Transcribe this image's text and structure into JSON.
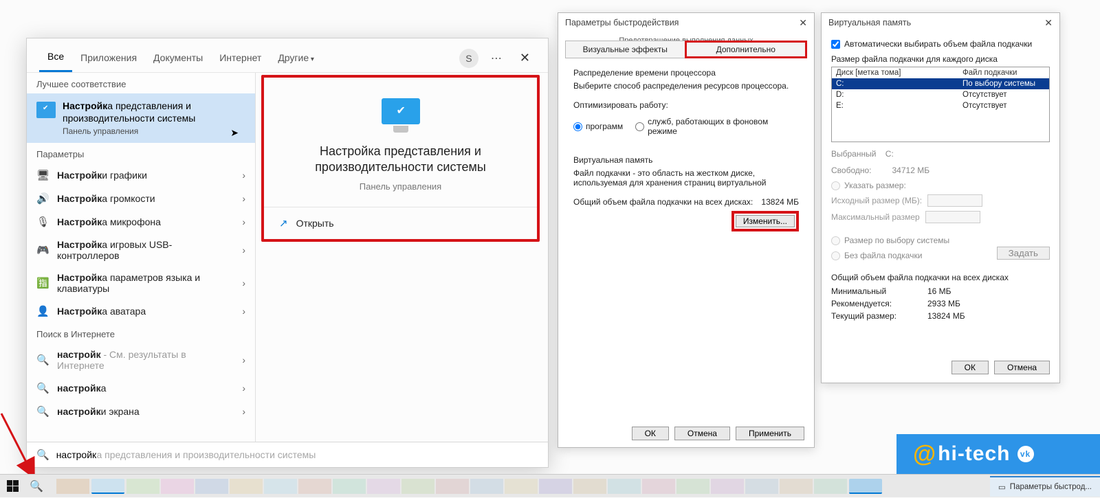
{
  "search": {
    "tabs": {
      "all": "Все",
      "apps": "Приложения",
      "docs": "Документы",
      "web": "Интернет",
      "more": "Другие"
    },
    "avatar_letter": "S",
    "section_best": "Лучшее соответствие",
    "best_match": {
      "title_prefix": "Настройк",
      "title_rest": "а представления и производительности системы",
      "sub": "Панель управления"
    },
    "section_params": "Параметры",
    "params": [
      {
        "icon": "🖥",
        "bold": "Настройк",
        "rest": "и графики"
      },
      {
        "icon": "🔊",
        "bold": "Настройк",
        "rest": "а громкости"
      },
      {
        "icon": "🎙",
        "bold": "Настройк",
        "rest": "а микрофона"
      },
      {
        "icon": "🎮",
        "bold": "Настройк",
        "rest": "а игровых USB-контроллеров"
      },
      {
        "icon": "🈯",
        "bold": "Настройк",
        "rest": "а параметров языка и клавиатуры"
      },
      {
        "icon": "👤",
        "bold": "Настройк",
        "rest": "а аватара"
      }
    ],
    "section_web": "Поиск в Интернете",
    "web_items": [
      {
        "bold": "настройк",
        "rest": "",
        "hint": " - См. результаты в Интернете"
      },
      {
        "bold": "настройк",
        "rest": "а",
        "hint": ""
      },
      {
        "bold": "настройк",
        "rest": "и экрана",
        "hint": ""
      }
    ],
    "preview": {
      "title": "Настройка представления и производительности системы",
      "sub": "Панель управления",
      "open": "Открыть"
    },
    "typed": "настройк",
    "autocomplete": "а представления и производительности системы"
  },
  "perf": {
    "title": "Параметры быстродействия",
    "dep_text": "Предотвращение выполнения данных",
    "tab_visual": "Визуальные эффекты",
    "tab_adv": "Дополнительно",
    "cpu_group": "Распределение времени процессора",
    "cpu_desc": "Выберите способ распределения ресурсов процессора.",
    "opt_label": "Оптимизировать работу:",
    "radio_programs": "программ",
    "radio_services": "служб, работающих в фоновом режиме",
    "vm_group": "Виртуальная память",
    "vm_desc": "Файл подкачки - это область на жестком диске, используемая для хранения страниц виртуальной",
    "vm_total_label": "Общий объем файла подкачки на всех дисках:",
    "vm_total_value": "13824 МБ",
    "change_btn": "Изменить...",
    "ok": "ОК",
    "cancel": "Отмена",
    "apply": "Применить"
  },
  "vm": {
    "title": "Виртуальная память",
    "auto_check": "Автоматически выбирать объем файла подкачки",
    "list_label": "Размер файла подкачки для каждого диска",
    "col_drive": "Диск [метка тома]",
    "col_file": "Файл подкачки",
    "rows": [
      {
        "drive": "C:",
        "file": "По выбору системы",
        "sel": true
      },
      {
        "drive": "D:",
        "file": "Отсутствует",
        "sel": false
      },
      {
        "drive": "E:",
        "file": "Отсутствует",
        "sel": false
      }
    ],
    "selected_label": "Выбранный",
    "selected_drive": "C:",
    "free_label": "Свободно:",
    "free_value": "34712 МБ",
    "radio_custom": "Указать размер:",
    "initial_label": "Исходный размер (МБ):",
    "max_label": "Максимальный размер",
    "radio_system": "Размер по выбору системы",
    "radio_none": "Без файла подкачки",
    "set_btn": "Задать",
    "total_group": "Общий объем файла подкачки на всех дисках",
    "min_label": "Минимальный",
    "min_val": "16 МБ",
    "rec_label": "Рекомендуется:",
    "rec_val": "2933 МБ",
    "cur_label": "Текущий размер:",
    "cur_val": "13824 МБ",
    "ok": "ОК",
    "cancel": "Отмена"
  },
  "taskbar": {
    "tray_label": "Параметры быстрод..."
  },
  "badge": "hi-tech"
}
